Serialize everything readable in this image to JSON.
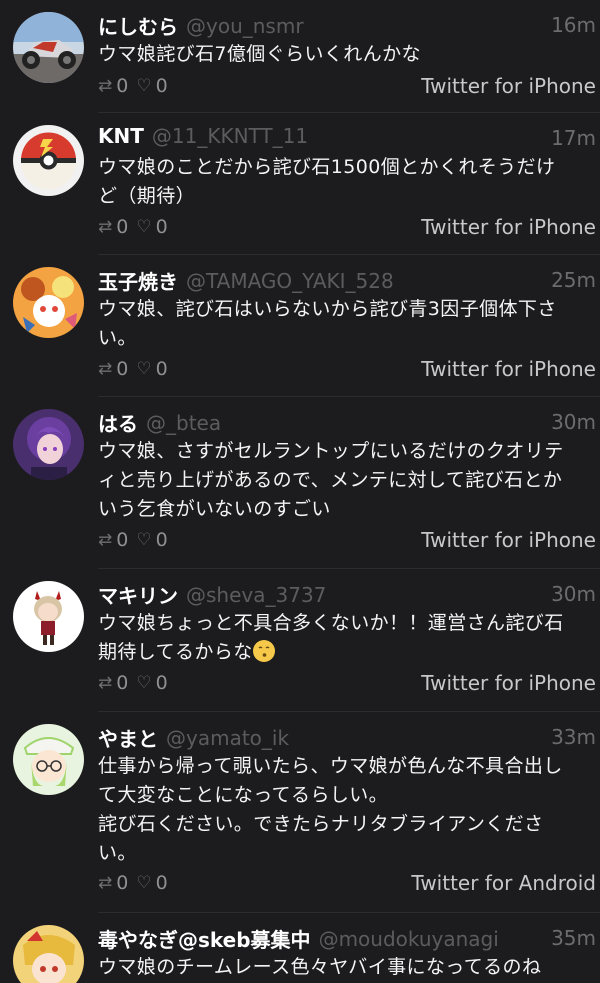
{
  "tweets": [
    {
      "name": "にしむら",
      "handle": "@you_nsmr",
      "time": "16m",
      "text": "ウマ娘詫び石7億個ぐらいくれんかな",
      "retweets": "0",
      "likes": "0",
      "via": "Twitter for iPhone",
      "avatar_icon": "motorcycle-avatar"
    },
    {
      "name": "KNT",
      "handle": "@11_KKNTT_11",
      "time": "17m",
      "text": "ウマ娘のことだから詫び石1500個とかくれそうだけ\nど（期待）",
      "retweets": "0",
      "likes": "0",
      "via": "Twitter for iPhone",
      "avatar_icon": "pokeball-avatar"
    },
    {
      "name": "玉子焼き",
      "handle": "@TAMAGO_YAKI_528",
      "time": "25m",
      "text": "ウマ娘、詫び石はいらないから詫び青3因子個体下さ\nい。",
      "retweets": "0",
      "likes": "0",
      "via": "Twitter for iPhone",
      "avatar_icon": "anime-character-avatar"
    },
    {
      "name": "はる",
      "handle": "@_btea",
      "time": "30m",
      "text": "ウマ娘、さすがセルラントップにいるだけのクオリテ\nィと売り上げがあるので、メンテに対して詫び石とか\nいう乞食がいないのすごい",
      "retweets": "0",
      "likes": "0",
      "via": "Twitter for iPhone",
      "avatar_icon": "purple-hair-avatar"
    },
    {
      "name": "マキリン",
      "handle": "@sheva_3737",
      "time": "30m",
      "text_line1": "ウマ娘ちょっと不具合多くないか！！運営さん詫び石",
      "text_line2": "期待してるからな",
      "emoji": "kissing-face-emoji",
      "retweets": "0",
      "likes": "0",
      "via": "Twitter for iPhone",
      "avatar_icon": "chibi-character-avatar"
    },
    {
      "name": "やまと",
      "handle": "@yamato_ik",
      "time": "33m",
      "text": "仕事から帰って覗いたら、ウマ娘が色んな不具合出し\nて大変なことになってるらしい。\n詫び石ください。できたらナリタブライアンくださ\nい。",
      "retweets": "0",
      "likes": "0",
      "via": "Twitter for Android",
      "avatar_icon": "glasses-character-avatar"
    },
    {
      "name": "毒やなぎ@skeb募集中",
      "handle": "@moudokuyanagi",
      "time": "35m",
      "text": "ウマ娘のチームレース色々ヤバイ事になってるのね",
      "avatar_icon": "blonde-character-avatar"
    }
  ],
  "icons": {
    "retweet": "retweet-icon",
    "like": "heart-icon"
  },
  "colors": {
    "background": "#1c1c1e",
    "handle": "#5c5c60",
    "time": "#6c6c70",
    "via": "#c7c7cc"
  }
}
